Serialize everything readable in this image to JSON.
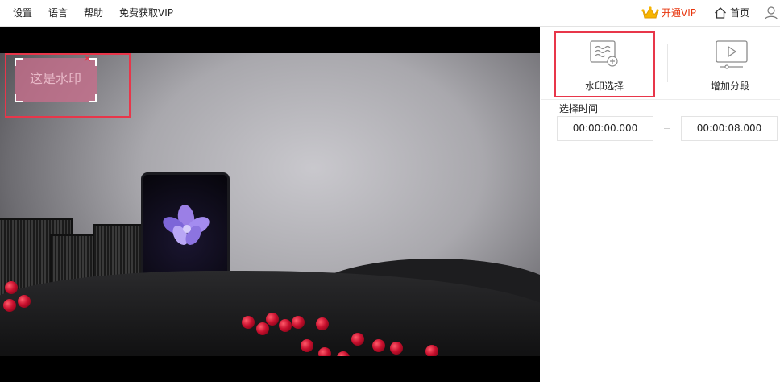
{
  "menu": {
    "settings": "设置",
    "language": "语言",
    "help": "帮助",
    "free_vip": "免费获取VIP"
  },
  "header": {
    "vip_label": "开通VIP",
    "home_label": "首页"
  },
  "icons": {
    "vip": "crown-icon",
    "home": "home-icon",
    "user": "user-icon",
    "watermark_tool": "watermark-icon",
    "segment_tool": "play-segment-icon",
    "close": "close-icon"
  },
  "colors": {
    "accent_red": "#e8364a",
    "vip_orange": "#e8360e"
  },
  "watermark": {
    "text": "这是水印"
  },
  "tools": {
    "watermark_select": "水印选择",
    "add_segment": "增加分段"
  },
  "time": {
    "title": "选择时间",
    "start": "00:00:00.000",
    "end": "00:00:08.000"
  }
}
